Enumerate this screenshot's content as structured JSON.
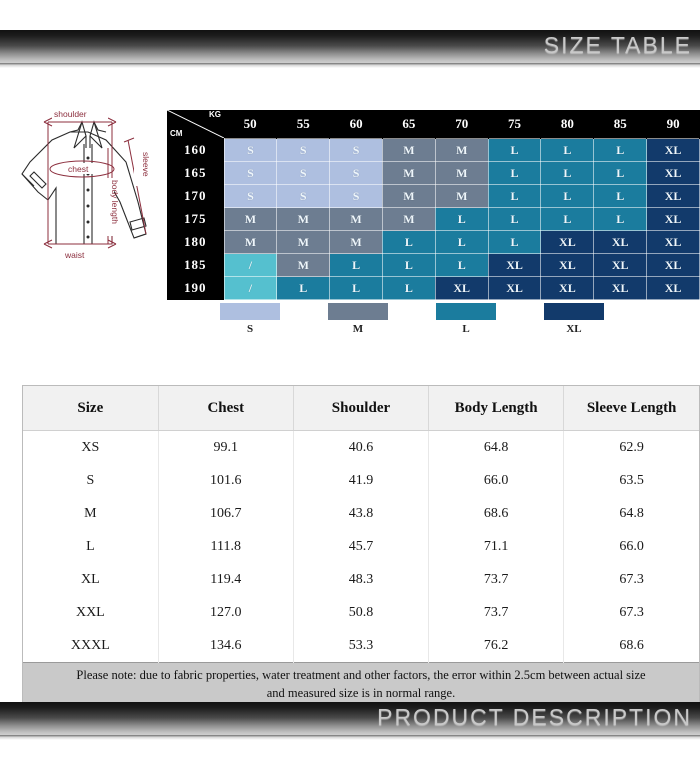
{
  "banners": {
    "top": "SIZE TABLE",
    "bottom": "PRODUCT DESCRIPTION"
  },
  "diagram": {
    "name": "shirt-measurement-diagram",
    "labels": {
      "shoulder": "shoulder",
      "chest": "chest",
      "body_length": "body length",
      "sleeve": "sleeve",
      "waist": "waist"
    }
  },
  "matrix": {
    "corner": {
      "kg": "KG",
      "cm": "CM"
    },
    "kg_headers": [
      "50",
      "55",
      "60",
      "65",
      "70",
      "75",
      "80",
      "85",
      "90"
    ],
    "cm_rows": [
      "160",
      "165",
      "170",
      "175",
      "180",
      "185",
      "190"
    ],
    "cells": [
      [
        "S",
        "S",
        "S",
        "M",
        "M",
        "L",
        "L",
        "L",
        "XL"
      ],
      [
        "S",
        "S",
        "S",
        "M",
        "M",
        "L",
        "L",
        "L",
        "XL"
      ],
      [
        "S",
        "S",
        "S",
        "M",
        "M",
        "L",
        "L",
        "L",
        "XL"
      ],
      [
        "M",
        "M",
        "M",
        "M",
        "L",
        "L",
        "L",
        "L",
        "XL"
      ],
      [
        "M",
        "M",
        "M",
        "L",
        "L",
        "L",
        "XL",
        "XL",
        "XL"
      ],
      [
        "/",
        "M",
        "L",
        "L",
        "L",
        "XL",
        "XL",
        "XL",
        "XL"
      ],
      [
        "/",
        "L",
        "L",
        "L",
        "XL",
        "XL",
        "XL",
        "XL",
        "XL"
      ]
    ]
  },
  "legend": {
    "items": [
      {
        "label": "S",
        "color": "#aebfe0"
      },
      {
        "label": "M",
        "color": "#6d7d91"
      },
      {
        "label": "L",
        "color": "#1b7c9e"
      },
      {
        "label": "XL",
        "color": "#123a6b"
      }
    ]
  },
  "measurement_table": {
    "columns": [
      "Size",
      "Chest",
      "Shoulder",
      "Body Length",
      "Sleeve Length"
    ],
    "rows": [
      [
        "XS",
        "99.1",
        "40.6",
        "64.8",
        "62.9"
      ],
      [
        "S",
        "101.6",
        "41.9",
        "66.0",
        "63.5"
      ],
      [
        "M",
        "106.7",
        "43.8",
        "68.6",
        "64.8"
      ],
      [
        "L",
        "111.8",
        "45.7",
        "71.1",
        "66.0"
      ],
      [
        "XL",
        "119.4",
        "48.3",
        "73.7",
        "67.3"
      ],
      [
        "XXL",
        "127.0",
        "50.8",
        "73.7",
        "67.3"
      ],
      [
        "XXXL",
        "134.6",
        "53.3",
        "76.2",
        "68.6"
      ]
    ],
    "note_line1": "Please note: due to fabric properties, water treatment and other factors, the error within 2.5cm between actual size",
    "note_line2": "and measured size is in normal range."
  }
}
